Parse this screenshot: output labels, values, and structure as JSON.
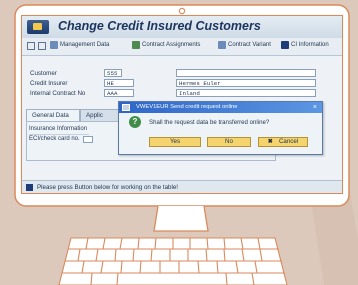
{
  "window": {
    "title": "Change Credit Insured Customers"
  },
  "toolbar": {
    "items": [
      "Management Data",
      "Contract Assignments",
      "Contract Variant",
      "CI Information"
    ]
  },
  "form": {
    "fields": [
      {
        "label": "Customer",
        "value": "555",
        "extra": ""
      },
      {
        "label": "Credit Insurer",
        "value": "HE",
        "extra": "Hermes Euler"
      },
      {
        "label": "Internal Contract No",
        "value": "AAA",
        "extra": "Inland"
      }
    ]
  },
  "tabs": [
    {
      "label": "General Data"
    },
    {
      "label": "Applic"
    }
  ],
  "panel": {
    "rows": [
      "Insurance Information",
      "ECI/check card no."
    ]
  },
  "status": {
    "message": "Please press Button below for working on the table!"
  },
  "dialog": {
    "title": "VWEV1EUR Send credit request online",
    "message": "Shall the request data be transferred online?",
    "close_glyph": "×",
    "yes_label": "Yes",
    "no_label": "No",
    "cancel_label": "Cancel",
    "cancel_glyph": "✖",
    "question_glyph": "?"
  },
  "colors": {
    "background": "#ddc9bc",
    "monitor_outline": "#d98a5c",
    "dialog_title": "#2d66c6",
    "button_yellow": "#f5d470",
    "question_green": "#3f8d48"
  }
}
